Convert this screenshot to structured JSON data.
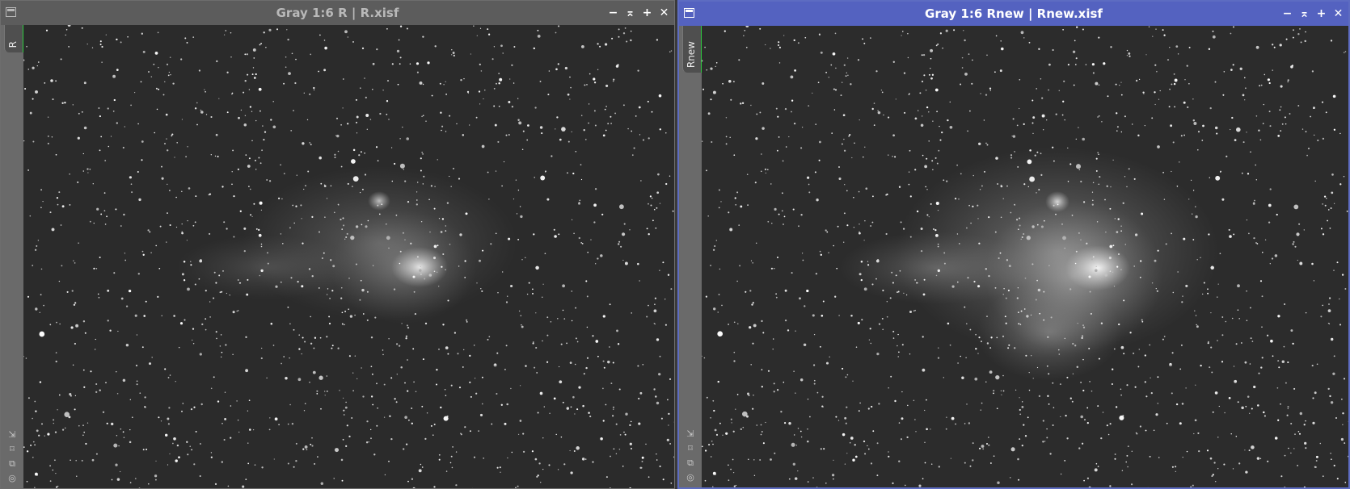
{
  "windows": [
    {
      "title": "Gray 1:6 R | R.xisf",
      "view_id": "R",
      "state": "inactive",
      "controls": {
        "minimize": "−",
        "shade": "⌅",
        "maximize": "+",
        "close": "✕"
      }
    },
    {
      "title": "Gray 1:6 Rnew | Rnew.xisf",
      "view_id": "Rnew",
      "state": "active",
      "controls": {
        "minimize": "−",
        "shade": "⌅",
        "maximize": "+",
        "close": "✕"
      }
    }
  ],
  "sidebar_icons": [
    "fit-view-icon",
    "zoom-icon",
    "clone-icon",
    "target-icon"
  ],
  "colors": {
    "active_title": "#5462c0",
    "inactive_title": "#5c5c5c",
    "view_tab_marker": "#2ecc40",
    "sky_background": "#2a2a2a"
  }
}
